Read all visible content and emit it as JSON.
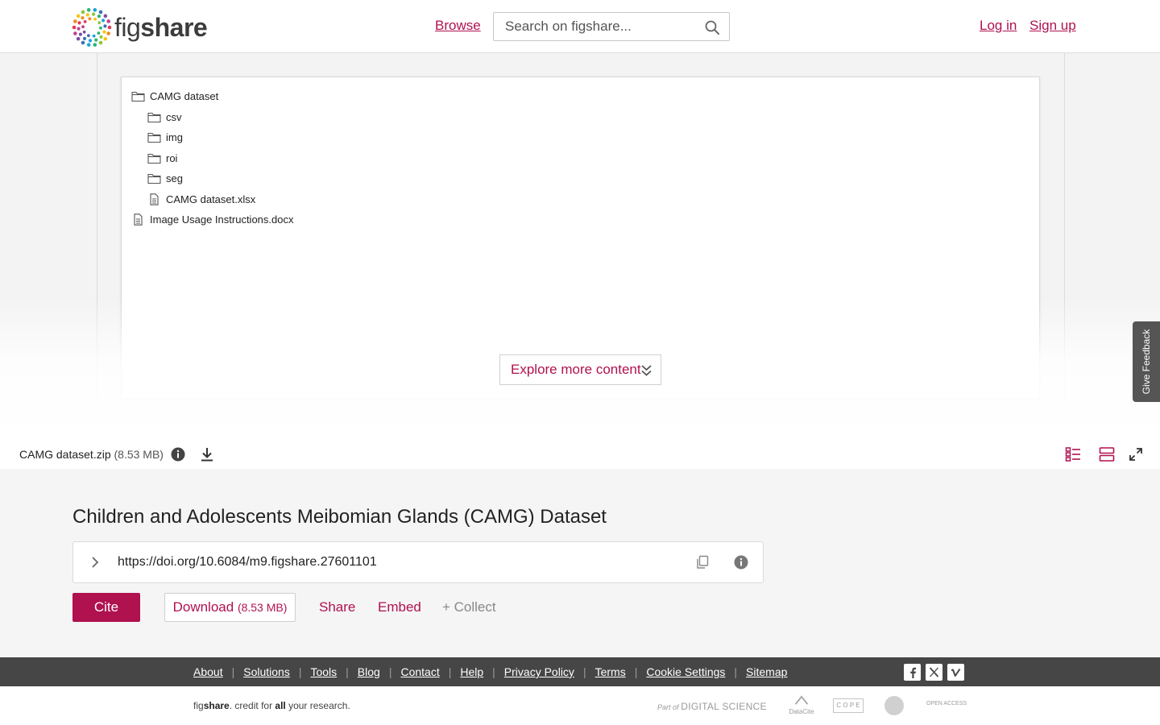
{
  "header": {
    "logo_text_prefix": "fig",
    "logo_text_suffix": "share",
    "browse_label": "Browse",
    "search_placeholder": "Search on figshare...",
    "login_label": "Log in",
    "signup_label": "Sign up"
  },
  "file_tree": {
    "root": "CAMG dataset",
    "children": [
      "csv",
      "img",
      "roi",
      "seg"
    ],
    "root_file": "CAMG dataset.xlsx",
    "top_file": "Image Usage Instructions.docx"
  },
  "preview": {
    "explore_label": "Explore more content"
  },
  "feedback": {
    "label": "Give Feedback"
  },
  "file_bar": {
    "file_name": "CAMG dataset.zip",
    "file_size": "(8.53 MB)"
  },
  "item": {
    "title": "Children and Adolescents Meibomian Glands (CAMG) Dataset",
    "doi": "https://doi.org/10.6084/m9.figshare.27601101",
    "cite_label": "Cite",
    "download_label": "Download",
    "download_size": "(8.53 MB)",
    "share_label": "Share",
    "embed_label": "Embed",
    "collect_label": "+ Collect"
  },
  "footer": {
    "links": [
      "About",
      "Solutions",
      "Tools",
      "Blog",
      "Contact",
      "Help",
      "Privacy Policy",
      "Terms",
      "Cookie Settings",
      "Sitemap"
    ],
    "tagline_fig": "fig",
    "tagline_share": "share",
    "tagline_mid": ". credit for ",
    "tagline_all": "all",
    "tagline_end": " your research.",
    "partners": {
      "digital_science_prefix": "Part of",
      "digital_science": "DIGITAL SCIENCE",
      "datacite": "DataCite",
      "cope": "C O P E",
      "open_access": "OPEN ACCESS"
    }
  },
  "colors": {
    "brand": "#b0114f",
    "footer_dark": "#464646"
  }
}
